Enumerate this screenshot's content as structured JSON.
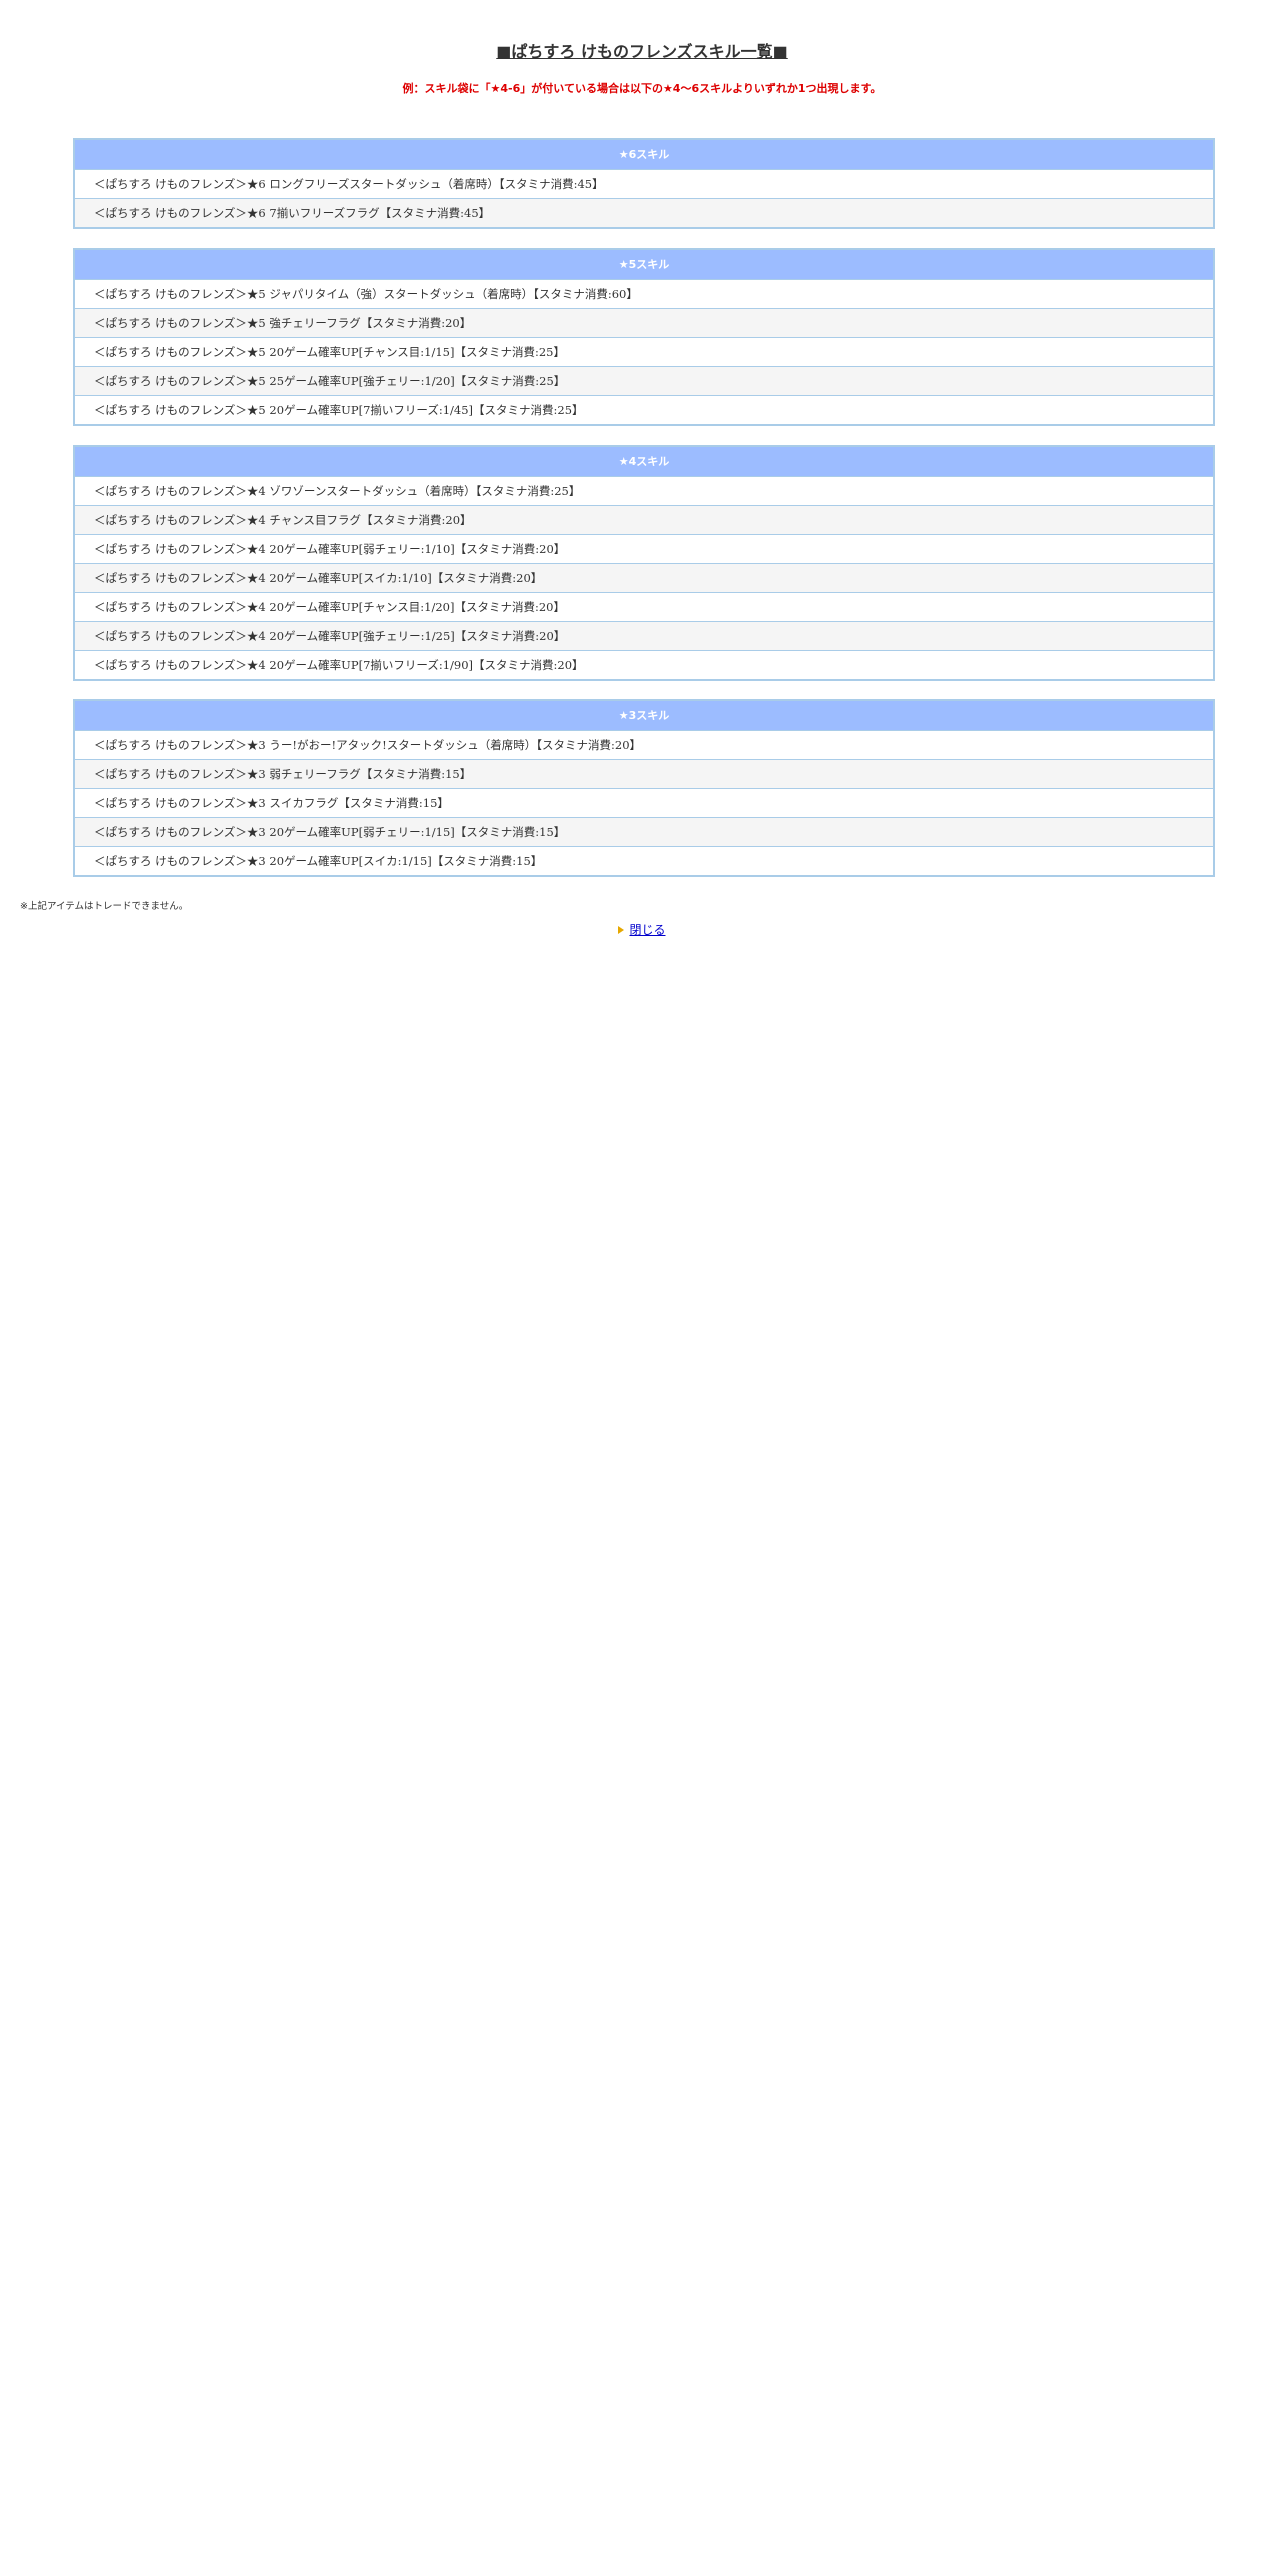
{
  "page": {
    "title": "■ぱちすろ けものフレンズスキル一覧■",
    "subtitle": "例：スキル袋に「★4-6」が付いている場合は以下の★4～6スキルよりいずれか1つ出現します。",
    "footnote": "※上記アイテムはトレードできません。",
    "close_label": "閉じる"
  },
  "tables": [
    {
      "header": "★6スキル",
      "rows": [
        "＜ぱちすろ けものフレンズ＞★6 ロングフリーズスタートダッシュ（着席時）【スタミナ消費:45】",
        "＜ぱちすろ けものフレンズ＞★6 7揃いフリーズフラグ【スタミナ消費:45】"
      ]
    },
    {
      "header": "★5スキル",
      "rows": [
        "＜ぱちすろ けものフレンズ＞★5 ジャパリタイム（強）スタートダッシュ（着席時）【スタミナ消費:60】",
        "＜ぱちすろ けものフレンズ＞★5 強チェリーフラグ【スタミナ消費:20】",
        "＜ぱちすろ けものフレンズ＞★5 20ゲーム確率UP[チャンス目:1/15]【スタミナ消費:25】",
        "＜ぱちすろ けものフレンズ＞★5 25ゲーム確率UP[強チェリー:1/20]【スタミナ消費:25】",
        "＜ぱちすろ けものフレンズ＞★5 20ゲーム確率UP[7揃いフリーズ:1/45]【スタミナ消費:25】"
      ]
    },
    {
      "header": "★4スキル",
      "rows": [
        "＜ぱちすろ けものフレンズ＞★4 ゾワゾーンスタートダッシュ（着席時）【スタミナ消費:25】",
        "＜ぱちすろ けものフレンズ＞★4 チャンス目フラグ【スタミナ消費:20】",
        "＜ぱちすろ けものフレンズ＞★4 20ゲーム確率UP[弱チェリー:1/10]【スタミナ消費:20】",
        "＜ぱちすろ けものフレンズ＞★4 20ゲーム確率UP[スイカ:1/10]【スタミナ消費:20】",
        "＜ぱちすろ けものフレンズ＞★4 20ゲーム確率UP[チャンス目:1/20]【スタミナ消費:20】",
        "＜ぱちすろ けものフレンズ＞★4 20ゲーム確率UP[強チェリー:1/25]【スタミナ消費:20】",
        "＜ぱちすろ けものフレンズ＞★4 20ゲーム確率UP[7揃いフリーズ:1/90]【スタミナ消費:20】"
      ]
    },
    {
      "header": "★3スキル",
      "rows": [
        "＜ぱちすろ けものフレンズ＞★3 うー!がおー!アタック!スタートダッシュ（着席時）【スタミナ消費:20】",
        "＜ぱちすろ けものフレンズ＞★3 弱チェリーフラグ【スタミナ消費:15】",
        "＜ぱちすろ けものフレンズ＞★3 スイカフラグ【スタミナ消費:15】",
        "＜ぱちすろ けものフレンズ＞★3 20ゲーム確率UP[弱チェリー:1/15]【スタミナ消費:15】",
        "＜ぱちすろ けものフレンズ＞★3 20ゲーム確率UP[スイカ:1/15]【スタミナ消費:15】"
      ]
    }
  ]
}
